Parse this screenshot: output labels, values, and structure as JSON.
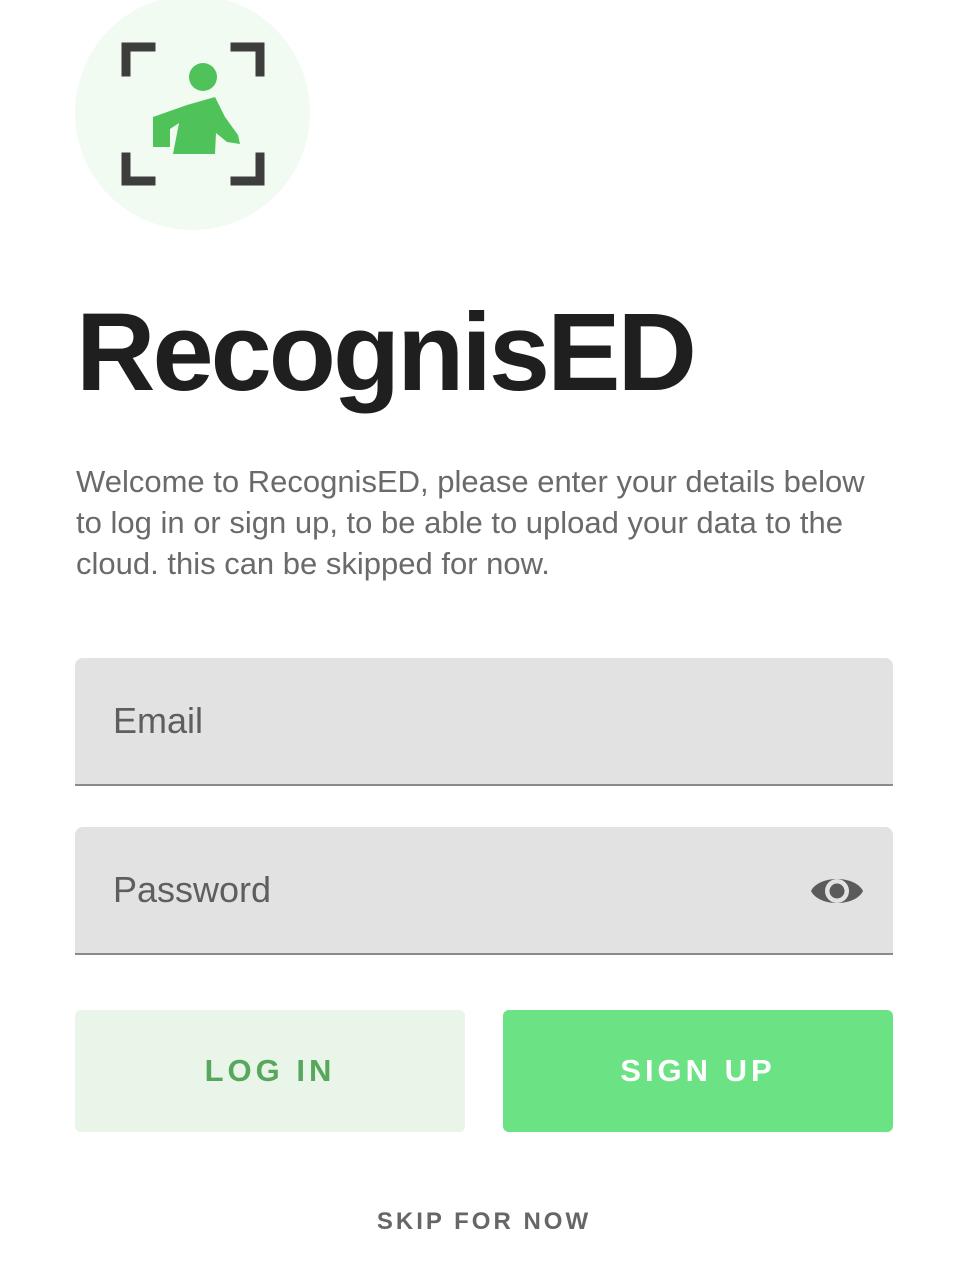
{
  "app": {
    "title": "RecognisED",
    "logo_icon": "face-scan-person-icon"
  },
  "intro": {
    "text": "Welcome to RecognisED, please enter your details below to log in or sign up, to be able to upload your data to the cloud. this can be skipped for now."
  },
  "form": {
    "email": {
      "placeholder": "Email",
      "value": ""
    },
    "password": {
      "placeholder": "Password",
      "value": "",
      "toggle_icon": "eye-icon"
    }
  },
  "actions": {
    "login_label": "LOG IN",
    "signup_label": "SIGN UP",
    "skip_label": "SKIP FOR NOW"
  },
  "colors": {
    "accent": "#6be384",
    "accent_dark": "#57a85c",
    "accent_light": "#e8f5e8",
    "field_bg": "#e2e2e2",
    "text_dark": "#1f1f1f"
  }
}
